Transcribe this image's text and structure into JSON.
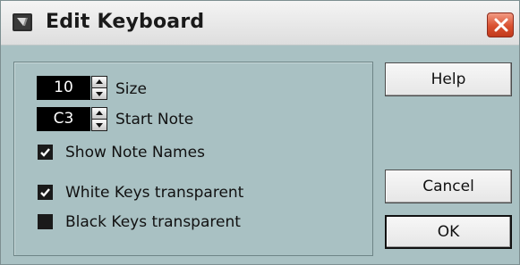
{
  "window": {
    "title": "Edit Keyboard",
    "icon": "cubase-logo-icon",
    "close_icon": "close-icon"
  },
  "settings": {
    "size": {
      "value": "10",
      "label": "Size"
    },
    "start_note": {
      "value": "C3",
      "label": "Start Note"
    },
    "checkboxes": [
      {
        "label": "Show Note Names",
        "checked": true
      },
      {
        "label": "White Keys transparent",
        "checked": true
      },
      {
        "label": "Black Keys transparent",
        "checked": false
      }
    ]
  },
  "buttons": {
    "help": "Help",
    "cancel": "Cancel",
    "ok": "OK"
  },
  "colors": {
    "dialog_bg": "#a9c1c3",
    "close_button": "#d9502f",
    "field_bg": "#000000"
  }
}
